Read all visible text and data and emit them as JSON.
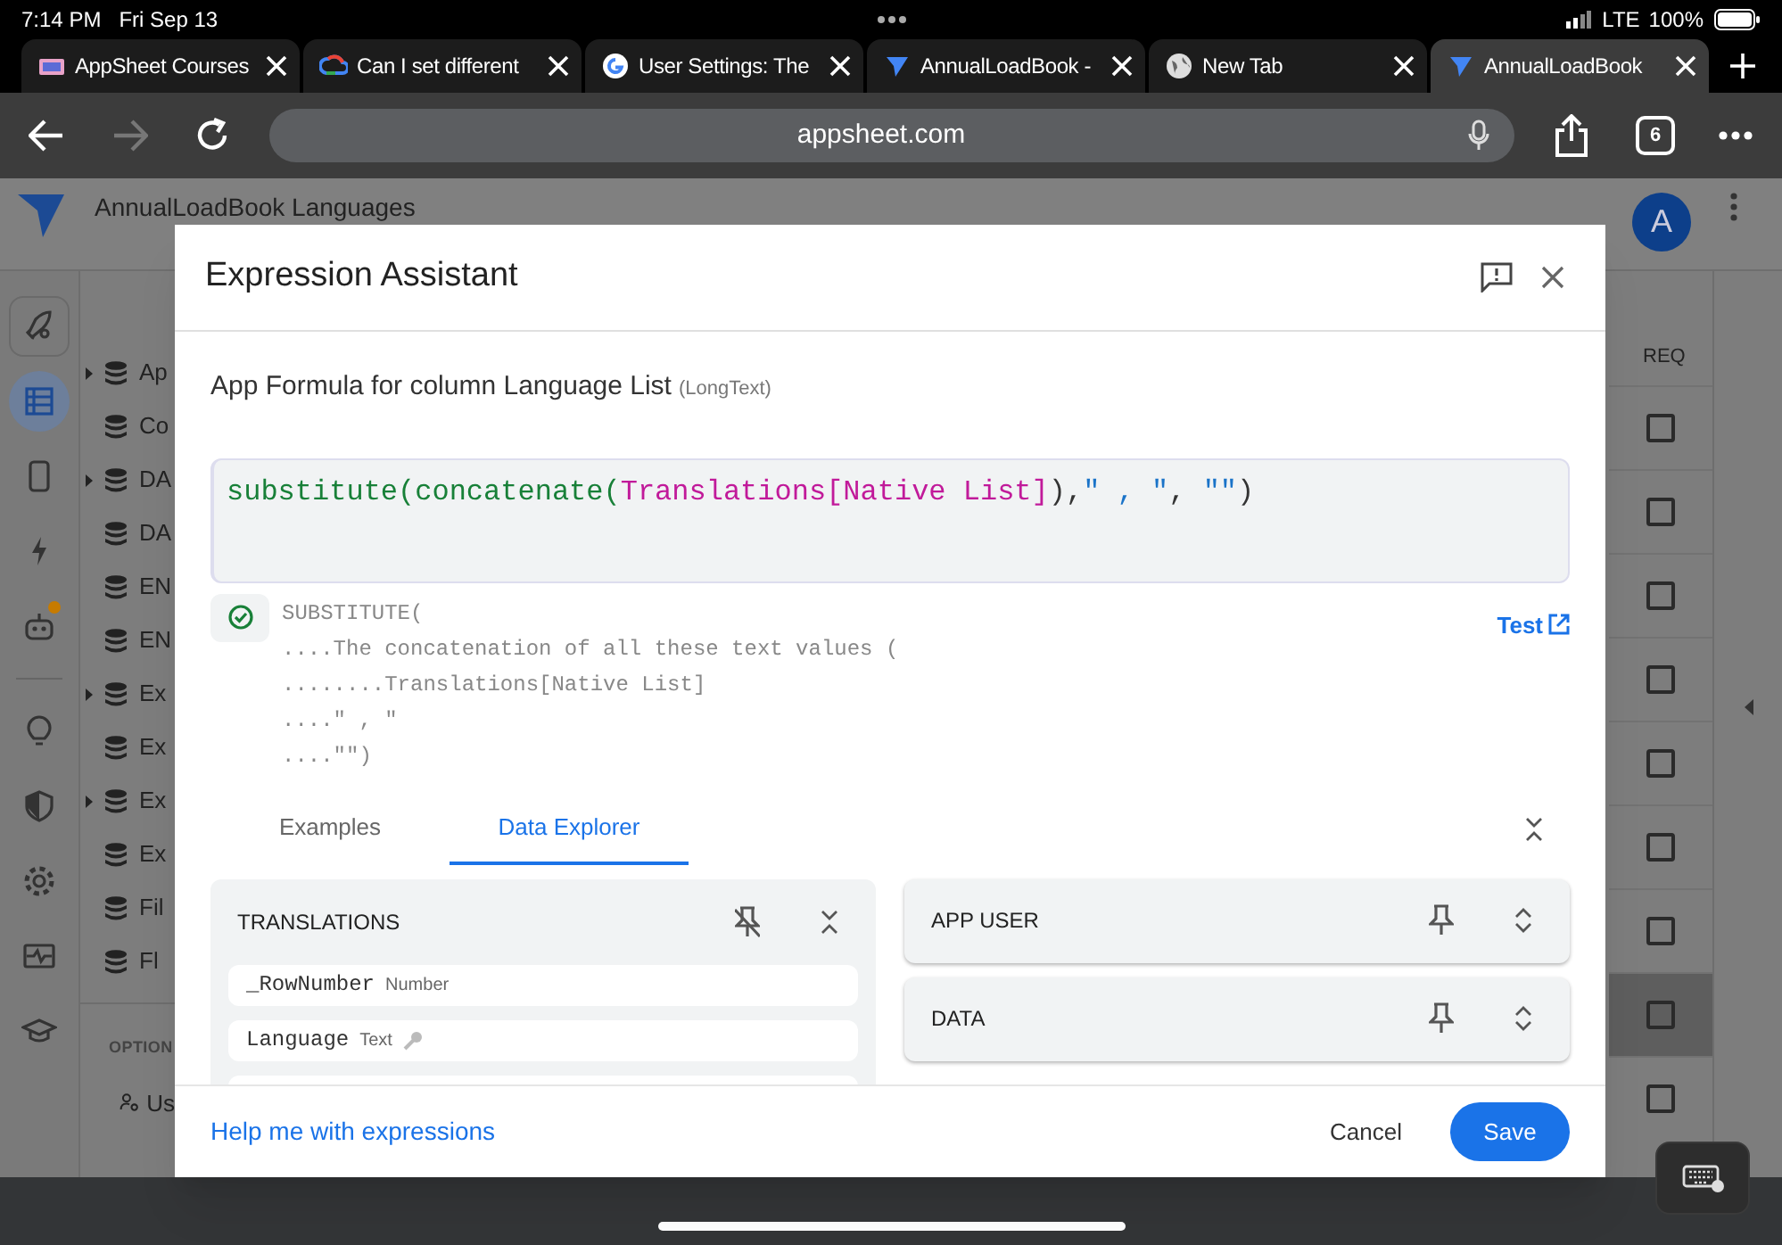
{
  "status_bar": {
    "time": "7:14 PM",
    "date": "Fri Sep 13",
    "network": "LTE",
    "battery": "100%"
  },
  "browser_tabs": [
    {
      "kind": "course",
      "title": "AppSheet Courses",
      "selected": false
    },
    {
      "kind": "cloud",
      "title": "Can I set different",
      "selected": false
    },
    {
      "kind": "google",
      "title": "User Settings: The",
      "selected": false
    },
    {
      "kind": "appsheet",
      "title": "AnnualLoadBook -",
      "selected": false
    },
    {
      "kind": "globe",
      "title": "New Tab",
      "selected": false
    },
    {
      "kind": "appsheet",
      "title": "AnnualLoadBook",
      "selected": true
    }
  ],
  "toolbar": {
    "address": "appsheet.com",
    "tab_count": "6",
    "forward_disabled": true
  },
  "app": {
    "title": "AnnualLoadBook Languages",
    "avatar": "A",
    "rail": [
      {
        "kind": "rocket",
        "selected": false,
        "badge": false
      },
      {
        "kind": "table",
        "selected": true,
        "badge": false
      },
      {
        "kind": "phone",
        "selected": false,
        "badge": false
      },
      {
        "kind": "bolt",
        "selected": false,
        "badge": false
      },
      {
        "kind": "robot",
        "selected": false,
        "badge": true
      },
      {
        "kind": "bulb",
        "selected": false,
        "badge": false
      },
      {
        "kind": "shield",
        "selected": false,
        "badge": false
      },
      {
        "kind": "gear",
        "selected": false,
        "badge": false
      },
      {
        "kind": "monitor",
        "selected": false,
        "badge": false
      },
      {
        "kind": "school",
        "selected": false,
        "badge": false
      }
    ],
    "tree": [
      {
        "label": "Ap",
        "expandable": true
      },
      {
        "label": "Co",
        "expandable": false
      },
      {
        "label": "DA",
        "expandable": true
      },
      {
        "label": "DA",
        "expandable": false
      },
      {
        "label": "EN",
        "expandable": false
      },
      {
        "label": "EN",
        "expandable": false
      },
      {
        "label": "Ex",
        "expandable": true
      },
      {
        "label": "Ex",
        "expandable": false
      },
      {
        "label": "Ex",
        "expandable": true
      },
      {
        "label": "Ex",
        "expandable": false
      },
      {
        "label": "Fil",
        "expandable": false
      },
      {
        "label": "Fl",
        "expandable": false
      }
    ],
    "options_heading": "OPTION",
    "options_item": "Us",
    "column_heading": "REQ",
    "rows": [
      {
        "checked": false,
        "selected": false
      },
      {
        "checked": false,
        "selected": false
      },
      {
        "checked": false,
        "selected": false
      },
      {
        "checked": false,
        "selected": false
      },
      {
        "checked": false,
        "selected": false
      },
      {
        "checked": false,
        "selected": false
      },
      {
        "checked": false,
        "selected": false
      },
      {
        "checked": false,
        "selected": true
      },
      {
        "checked": false,
        "selected": false
      }
    ]
  },
  "dialog": {
    "title": "Expression Assistant",
    "heading": "App Formula for column Language List",
    "heading_type": "(LongText)",
    "formula": [
      {
        "kind": "function",
        "text": "substitute("
      },
      {
        "kind": "function",
        "text": "concatenate("
      },
      {
        "kind": "column",
        "text": "Translations[Native List]"
      },
      {
        "kind": "plain",
        "text": "),"
      },
      {
        "kind": "string",
        "text": "\" , \""
      },
      {
        "kind": "plain",
        "text": ", "
      },
      {
        "kind": "string",
        "text": "\"\""
      },
      {
        "kind": "plain",
        "text": ")"
      }
    ],
    "valid": true,
    "explanation": [
      "SUBSTITUTE(",
      "....The concatenation of all these text values (",
      "........Translations[Native List]",
      "....\" , \"",
      "....\"\")"
    ],
    "test_link": "Test",
    "tabs": [
      {
        "label": "Examples",
        "selected": false
      },
      {
        "label": "Data Explorer",
        "selected": true
      }
    ],
    "left_panels": [
      {
        "title": "TRANSLATIONS",
        "pinned": true,
        "expanded": true,
        "fields": [
          {
            "name": "_RowNumber",
            "type": "Number",
            "key": false
          },
          {
            "name": "Language",
            "type": "Text",
            "key": true
          }
        ]
      }
    ],
    "right_panels": [
      {
        "title": "APP USER",
        "pinned": false,
        "expanded": false
      },
      {
        "title": "DATA",
        "pinned": false,
        "expanded": false
      }
    ],
    "help_link": "Help me with expressions",
    "cancel": "Cancel",
    "save": "Save"
  }
}
